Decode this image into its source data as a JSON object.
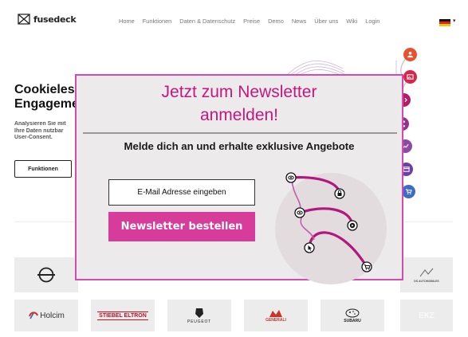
{
  "brand": {
    "name": "fusedeck",
    "icon": "fusedeck-logo-icon"
  },
  "nav": {
    "items": [
      "Home",
      "Funktionen",
      "Daten & Datenschutz",
      "Preise",
      "Demo",
      "News",
      "Über uns",
      "Wiki",
      "Login"
    ],
    "language_icon": "german-flag-icon"
  },
  "hero": {
    "title": "Cookieless\nEngagement",
    "subtitle": "Analysieren Sie mit\nIhre Daten nutzbar\nUser-Consent.",
    "button": "Funktionen"
  },
  "rail_icons": [
    {
      "icon": "user-icon",
      "color": "#e8522f"
    },
    {
      "icon": "image-icon",
      "color": "#d8264b"
    },
    {
      "icon": "code-icon",
      "color": "#b21d65"
    },
    {
      "icon": "share-icon",
      "color": "#9a2f8c"
    },
    {
      "icon": "chart-icon",
      "color": "#8e49a6"
    },
    {
      "icon": "window-icon",
      "color": "#6c3fa3"
    },
    {
      "icon": "cart-icon",
      "color": "#3f6bc4"
    }
  ],
  "logos": {
    "row1": [
      "opel-logo",
      "ds-automobiles-logo"
    ],
    "ds_text": "DS AUTOMOBILES",
    "row2": [
      {
        "icon": "holcim-logo",
        "text": "Holcim"
      },
      {
        "icon": "stiebel-eltron-logo",
        "text": "STIEBEL ELTRON"
      },
      {
        "icon": "peugeot-logo",
        "text": "PEUGEOT"
      },
      {
        "icon": "generali-logo",
        "text": "GENERALI"
      },
      {
        "icon": "subaru-logo",
        "text": "SUBARU"
      },
      {
        "icon": "ekz-logo",
        "text": "EKZ"
      }
    ]
  },
  "modal": {
    "title": "Jetzt zum Newsletter\nanmelden!",
    "subtitle": "Melde dich an und erhalte exklusive Angebote",
    "email_placeholder": "E-Mail Adresse eingeben",
    "submit_label": "Newsletter bestellen",
    "accent": "#d83c9a",
    "art_icons": [
      "eye-icon",
      "lock-icon",
      "eye-icon",
      "play-icon",
      "cursor-icon",
      "cart-icon"
    ]
  }
}
